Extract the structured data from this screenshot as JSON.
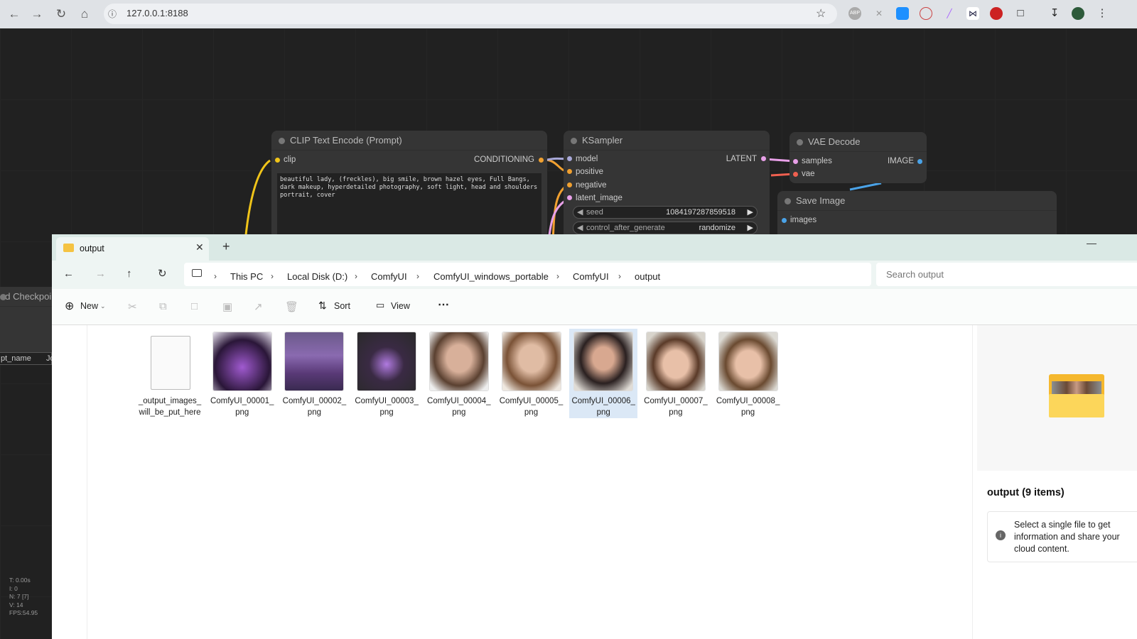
{
  "browser": {
    "url": "127.0.0.1:8188",
    "icons": [
      "back-icon",
      "forward-icon",
      "reload-icon",
      "home-icon",
      "site-info-icon",
      "star-icon",
      "adblock-icon",
      "extension-icon",
      "extension-icon",
      "extension-icon",
      "extension-icon",
      "extension-icon",
      "extension-icon",
      "puzzle-icon",
      "download-icon",
      "profile-avatar",
      "menu-icon"
    ]
  },
  "nodes": {
    "clip": {
      "title": "CLIP Text Encode (Prompt)",
      "input": "clip",
      "output": "CONDITIONING",
      "prompt": "beautiful lady, (freckles), big smile, brown hazel eyes, Full Bangs, dark makeup, hyperdetailed photography, soft light, head and shoulders portrait, cover"
    },
    "ksampler": {
      "title": "KSampler",
      "inputs": [
        "model",
        "positive",
        "negative",
        "latent_image"
      ],
      "output": "LATENT",
      "seed_label": "seed",
      "seed": "1084197287859518",
      "cag_label": "control_after_generate",
      "cag": "randomize"
    },
    "vae": {
      "title": "VAE Decode",
      "inputs": [
        "samples",
        "vae"
      ],
      "output": "IMAGE"
    },
    "save": {
      "title": "Save Image",
      "input": "images"
    },
    "checkpoint": {
      "title": "ad Checkpoi",
      "widget": "pt_name",
      "value": "Jo"
    }
  },
  "stats": [
    "T: 0.00s",
    "I: 0",
    "N: 7 [7]",
    "V: 14",
    "FPS:54.95"
  ],
  "explorer": {
    "tab_title": "output",
    "breadcrumbs": [
      "This PC",
      "Local Disk (D:)",
      "ComfyUI",
      "ComfyUI_windows_portable",
      "ComfyUI",
      "output"
    ],
    "search_placeholder": "Search output",
    "toolbar": {
      "new": "New",
      "sort": "Sort",
      "view": "View"
    },
    "files": [
      {
        "line1": "_output_images_",
        "line2": "will_be_put_here",
        "type": "document"
      },
      {
        "line1": "ComfyUI_00001_",
        "line2": "png",
        "type": "image"
      },
      {
        "line1": "ComfyUI_00002_",
        "line2": "png",
        "type": "image"
      },
      {
        "line1": "ComfyUI_00003_",
        "line2": "png",
        "type": "image"
      },
      {
        "line1": "ComfyUI_00004_",
        "line2": "png",
        "type": "image"
      },
      {
        "line1": "ComfyUI_00005_",
        "line2": "png",
        "type": "image"
      },
      {
        "line1": "ComfyUI_00006_",
        "line2": "png",
        "type": "image",
        "selected": true
      },
      {
        "line1": "ComfyUI_00007_",
        "line2": "png",
        "type": "image"
      },
      {
        "line1": "ComfyUI_00008_",
        "line2": "png",
        "type": "image"
      }
    ],
    "details": {
      "title": "output (9 items)",
      "info": "Select a single file to get information and share your cloud content."
    }
  }
}
